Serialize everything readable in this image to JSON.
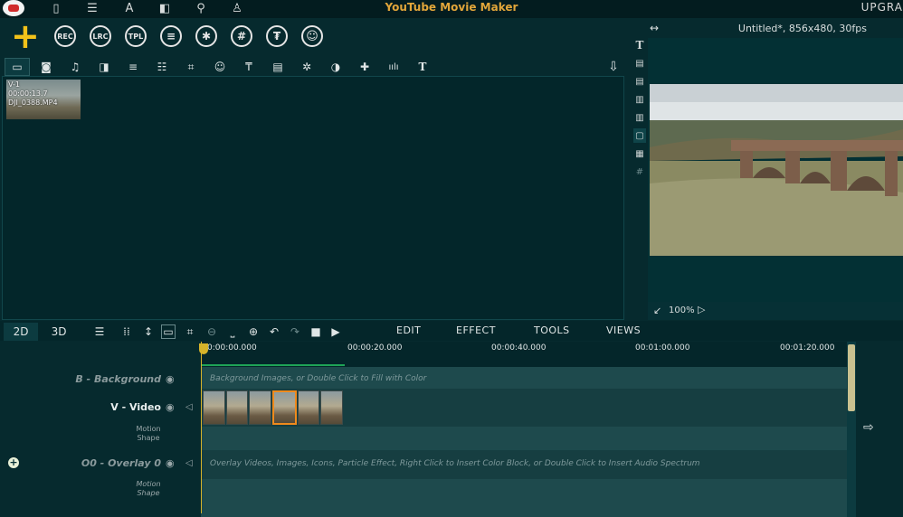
{
  "app": {
    "title": "YouTube Movie Maker",
    "upgrade": "UPGRA"
  },
  "top_icons": [
    "book-icon",
    "list-icon",
    "text-effect-icon",
    "panel-icon",
    "search-icon",
    "shirt-icon"
  ],
  "main_toolbar": {
    "add": "+",
    "buttons": [
      "REC",
      "LRC",
      "TPL",
      "≡",
      "✱",
      "#",
      "₮",
      "☺"
    ]
  },
  "media_tabs": [
    "video-tab",
    "photo-tab",
    "music-tab",
    "transition-tab",
    "subtitle-tab",
    "list-tab",
    "grid-tab",
    "emoji-tab",
    "shape-tab",
    "film-tab",
    "particle-tab",
    "color-tab",
    "puzzle-tab",
    "spectrum-tab",
    "text-tab"
  ],
  "media_tab_glyphs": [
    "▭",
    "◙",
    "♫",
    "◨",
    "≡",
    "☷",
    "⌗",
    "☺",
    "₸",
    "▤",
    "✲",
    "◑",
    "✚",
    "ıılı",
    "T"
  ],
  "download_glyph": "⇩",
  "clip": {
    "name": "V-1",
    "duration": "00:00:13.7",
    "file": "DJI_0388.MP4"
  },
  "vertical_tools": [
    "T",
    "▤",
    "▤",
    "▥",
    "▥",
    "▢",
    "▦",
    "#"
  ],
  "preview": {
    "info": "Untitled*, 856x480, 30fps",
    "zoom": "100%"
  },
  "timeline": {
    "tabs": {
      "tab_2d": "2D",
      "tab_3d": "3D"
    },
    "menu": {
      "edit": "EDIT",
      "effect": "EFFECT",
      "tools": "TOOLS",
      "views": "VIEWS"
    },
    "ticks": [
      "0:00:00.000",
      "00:00:20.000",
      "00:00:40.000",
      "00:01:00.000",
      "00:01:20.000"
    ],
    "tracks": {
      "background": {
        "name": "B - Background",
        "hint": "Background Images, or Double Click to Fill with Color"
      },
      "video": {
        "name": "V - Video",
        "sub1": "Motion",
        "sub2": "Shape"
      },
      "overlay": {
        "name": "O0 - Overlay 0",
        "hint": "Overlay Videos, Images, Icons, Particle Effect, Right Click to Insert Color Block, or Double Click to Insert Audio Spectrum",
        "sub1": "Motion",
        "sub2": "Shape"
      }
    }
  }
}
